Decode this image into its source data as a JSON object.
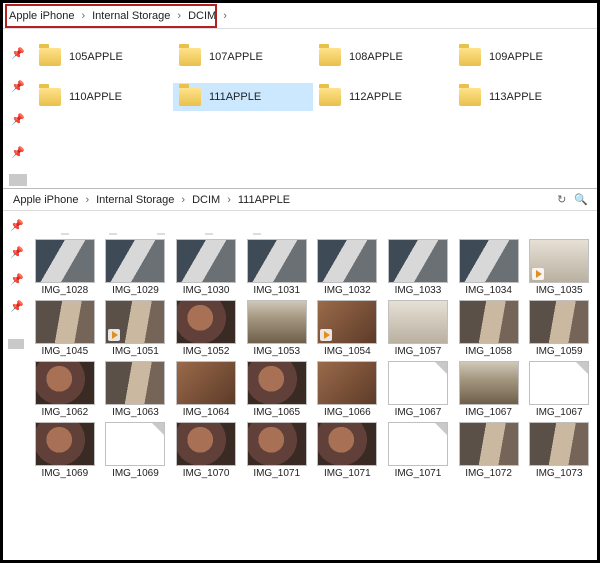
{
  "top": {
    "breadcrumb": [
      "Apple iPhone",
      "Internal Storage",
      "DCIM"
    ],
    "folders": [
      {
        "name": "105APPLE",
        "selected": false
      },
      {
        "name": "107APPLE",
        "selected": false
      },
      {
        "name": "108APPLE",
        "selected": false
      },
      {
        "name": "109APPLE",
        "selected": false
      },
      {
        "name": "110APPLE",
        "selected": false
      },
      {
        "name": "111APPLE",
        "selected": true
      },
      {
        "name": "112APPLE",
        "selected": false
      },
      {
        "name": "113APPLE",
        "selected": false
      }
    ]
  },
  "bottom": {
    "breadcrumb": [
      "Apple iPhone",
      "Internal Storage",
      "DCIM",
      "111APPLE"
    ],
    "rows": [
      [
        {
          "label": "IMG_1028",
          "tex": "t1"
        },
        {
          "label": "IMG_1029",
          "tex": "t1"
        },
        {
          "label": "IMG_1030",
          "tex": "t1"
        },
        {
          "label": "IMG_1031",
          "tex": "t1"
        },
        {
          "label": "IMG_1032",
          "tex": "t1"
        },
        {
          "label": "IMG_1033",
          "tex": "t1"
        },
        {
          "label": "IMG_1034",
          "tex": "t1"
        },
        {
          "label": "IMG_1035",
          "tex": "t6",
          "video": true
        }
      ],
      [
        {
          "label": "IMG_1045",
          "tex": "t2"
        },
        {
          "label": "IMG_1051",
          "tex": "t2",
          "video": true
        },
        {
          "label": "IMG_1052",
          "tex": "t3"
        },
        {
          "label": "IMG_1053",
          "tex": "t4"
        },
        {
          "label": "IMG_1054",
          "tex": "t5",
          "video": true
        },
        {
          "label": "IMG_1057",
          "tex": "t6"
        },
        {
          "label": "IMG_1058",
          "tex": "t2"
        },
        {
          "label": "IMG_1059",
          "tex": "t2"
        }
      ],
      [
        {
          "label": "IMG_1062",
          "tex": "t3"
        },
        {
          "label": "IMG_1063",
          "tex": "t2"
        },
        {
          "label": "IMG_1064",
          "tex": "t5"
        },
        {
          "label": "IMG_1065",
          "tex": "t3"
        },
        {
          "label": "IMG_1066",
          "tex": "t5"
        },
        {
          "label": "IMG_1067",
          "blank": true
        },
        {
          "label": "IMG_1067",
          "tex": "t4"
        },
        {
          "label": "IMG_1067",
          "blank": true
        }
      ],
      [
        {
          "label": "IMG_1069",
          "tex": "t3"
        },
        {
          "label": "IMG_1069",
          "blank": true
        },
        {
          "label": "IMG_1070",
          "tex": "t3"
        },
        {
          "label": "IMG_1071",
          "tex": "t3"
        },
        {
          "label": "IMG_1071",
          "tex": "t3"
        },
        {
          "label": "IMG_1071",
          "blank": true
        },
        {
          "label": "IMG_1072",
          "tex": "t2"
        },
        {
          "label": "IMG_1073",
          "tex": "t2"
        }
      ]
    ]
  }
}
